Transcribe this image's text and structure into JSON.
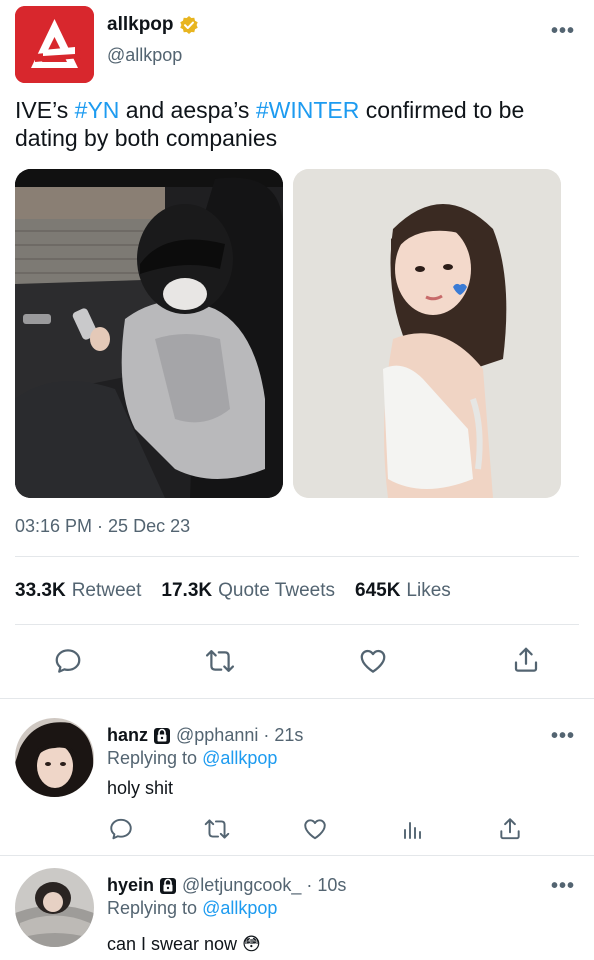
{
  "tweet": {
    "author_name": "allkpop",
    "author_handle": "@allkpop",
    "more": "•••",
    "text_parts": [
      "IVE’s ",
      "#YN",
      " and aespa’s ",
      "#WINTER",
      " confirmed to be dating by both companies"
    ],
    "timestamp": "03:16 PM · 25 Dec 23",
    "stats": {
      "retweets_value": "33.3K",
      "retweets_label": "Retweet",
      "quotes_value": "17.3K",
      "quotes_label": "Quote Tweets",
      "likes_value": "645K",
      "likes_label": "Likes"
    }
  },
  "replies": [
    {
      "name": "hanz",
      "handle": "@pphanni",
      "time": "· 21s",
      "replying_prefix": "Replying to",
      "replying_to": "@allkpop",
      "text": "holy shit",
      "more": "•••"
    },
    {
      "name": "hyein",
      "handle": "@letjungcook_",
      "time": "· 10s",
      "replying_prefix": "Replying to",
      "replying_to": "@allkpop",
      "text": "can I swear now 😳",
      "more": "•••"
    }
  ],
  "colors": {
    "accent": "#1d9bf0",
    "muted": "#536471",
    "brand": "#d8272d",
    "verified": "#e8b520"
  }
}
